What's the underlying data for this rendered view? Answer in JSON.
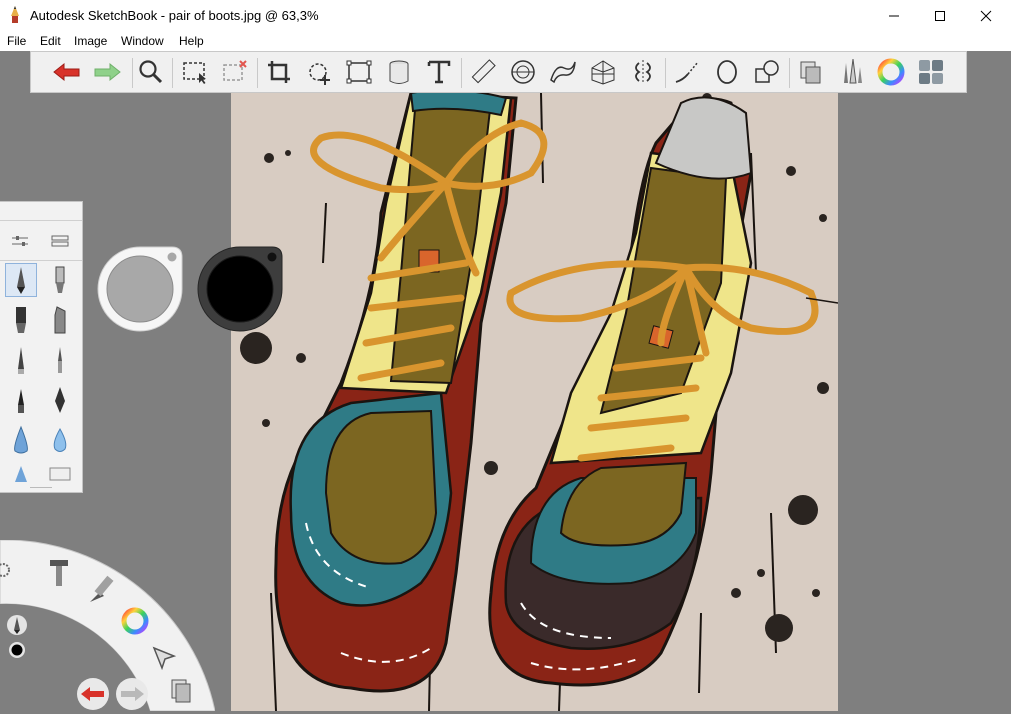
{
  "window": {
    "title": "Autodesk SketchBook - pair of boots.jpg @ 63,3%",
    "minimize_icon": "minimize-icon",
    "maximize_icon": "maximize-icon",
    "close_icon": "close-icon"
  },
  "menu": [
    "File",
    "Edit",
    "Image",
    "Window",
    "Help"
  ],
  "toolbar": {
    "tools": [
      "undo",
      "redo",
      "zoom",
      "select",
      "deselect",
      "crop",
      "transform",
      "distort",
      "fill",
      "text",
      "ruler",
      "ellipse-guide",
      "french-curve",
      "perspective",
      "symmetry",
      "stroke-line",
      "stroke-ellipse",
      "shapes",
      "layers",
      "brushes",
      "color-wheel",
      "copic-library"
    ]
  },
  "colors": {
    "accent_red": "#d8322a",
    "redo_green": "#8fd18a",
    "canvas_bg": "#d8ccc2",
    "boot_yellow": "#efe58a",
    "boot_teal": "#2f7b86",
    "boot_red": "#8a2416",
    "boot_olive": "#7c6621",
    "lace_orange": "#d9952e"
  },
  "brush_palette": {
    "tabs": [
      "brush-properties",
      "brush-library"
    ],
    "brushes": [
      "pencil",
      "airbrush",
      "marker",
      "chisel-marker",
      "ballpoint",
      "paint-brush",
      "ink-pen",
      "fountain-pen",
      "smudge",
      "water-drop",
      "triangle-brush",
      "eraser"
    ]
  },
  "puck": {
    "primary": "#a8a8a8",
    "secondary": "#000000"
  },
  "lagoon": {
    "items": [
      "tools",
      "brush",
      "color",
      "select",
      "undo",
      "redo",
      "layers"
    ]
  }
}
